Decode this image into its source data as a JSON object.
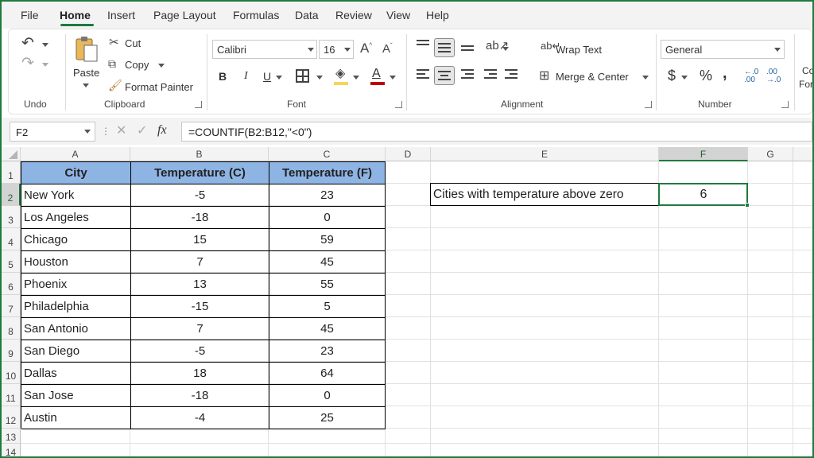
{
  "menu": [
    "File",
    "Home",
    "Insert",
    "Page Layout",
    "Formulas",
    "Data",
    "Review",
    "View",
    "Help"
  ],
  "ribbon": {
    "undo_label": "Undo",
    "clipboard": {
      "paste": "Paste",
      "cut": "Cut",
      "copy": "Copy",
      "format_painter": "Format Painter",
      "label": "Clipboard"
    },
    "font": {
      "name": "Calibri",
      "size": "16",
      "bold": "B",
      "italic": "I",
      "underline": "U",
      "label": "Font",
      "fill_color": "#f5d65b",
      "font_color": "#c00000"
    },
    "alignment": {
      "wrap_text": "Wrap Text",
      "merge_center": "Merge & Center",
      "label": "Alignment"
    },
    "number": {
      "format": "General",
      "currency": "$",
      "percent": "%",
      "comma": ",",
      "label": "Number"
    },
    "cut_off": [
      "Co",
      "For"
    ]
  },
  "formula_bar": {
    "name_box": "F2",
    "formula": "=COUNTIF(B2:B12,\"<0\")"
  },
  "sheet": {
    "columns": [
      "A",
      "B",
      "C",
      "D",
      "E",
      "F",
      "G"
    ],
    "rows": [
      "1",
      "2",
      "3",
      "4",
      "5",
      "6",
      "7",
      "8",
      "9",
      "10",
      "11",
      "12",
      "13",
      "14"
    ],
    "headers": [
      "City",
      "Temperature (C)",
      "Temperature (F)"
    ],
    "data": [
      [
        "New York",
        "-5",
        "23"
      ],
      [
        "Los Angeles",
        "-18",
        "0"
      ],
      [
        "Chicago",
        "15",
        "59"
      ],
      [
        "Houston",
        "7",
        "45"
      ],
      [
        "Phoenix",
        "13",
        "55"
      ],
      [
        "Philadelphia",
        "-15",
        "5"
      ],
      [
        "San Antonio",
        "7",
        "45"
      ],
      [
        "San Diego",
        "-5",
        "23"
      ],
      [
        "Dallas",
        "18",
        "64"
      ],
      [
        "San Jose",
        "-18",
        "0"
      ],
      [
        "Austin",
        "-4",
        "25"
      ]
    ],
    "label_cell": "Cities with temperature above zero",
    "result_cell": "6",
    "header_fill": "#8eb4e3",
    "accent": "#1f7a3e"
  }
}
